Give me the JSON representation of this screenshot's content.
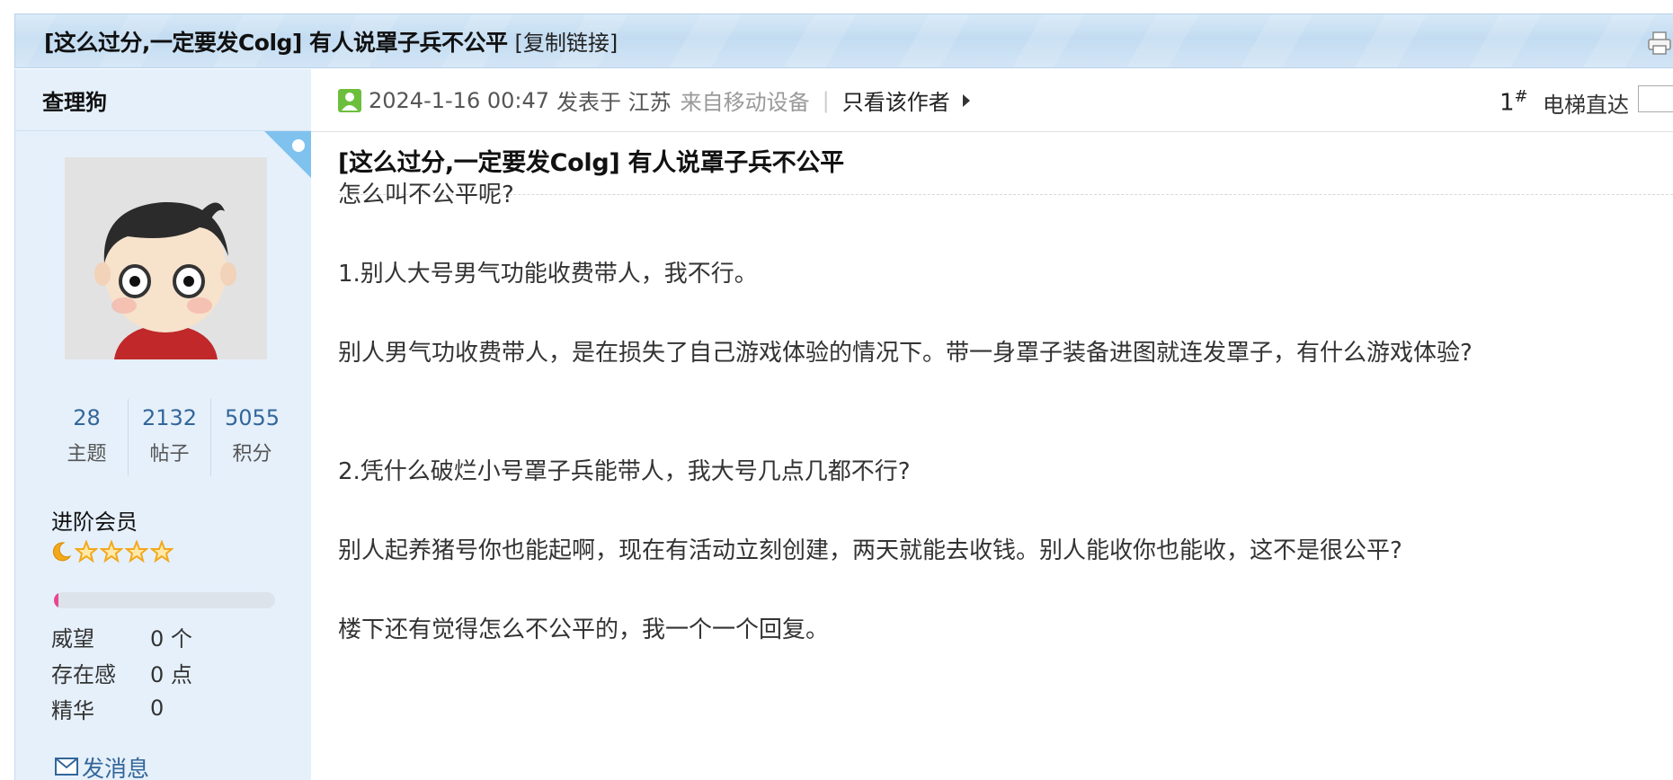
{
  "thread": {
    "title": "[这么过分,一定要发Colg] 有人说罩子兵不公平",
    "copy_link": "[复制链接]"
  },
  "author": {
    "name": "查理狗",
    "stats": [
      {
        "value": "28",
        "label": "主题"
      },
      {
        "value": "2132",
        "label": "帖子"
      },
      {
        "value": "5055",
        "label": "积分"
      }
    ],
    "level": "进阶会员",
    "level_progress": 0.02,
    "info": [
      {
        "key": "威望",
        "value": "0 个"
      },
      {
        "key": "存在感",
        "value": "0 点"
      },
      {
        "key": "精华",
        "value": "0"
      }
    ],
    "send_message": "发消息"
  },
  "post": {
    "date": "2024-1-16 00:47",
    "posted_in": "发表于 江苏",
    "mobile": "来自移动设备",
    "separator": "|",
    "only_author": "只看该作者",
    "floor": "1",
    "floor_mark": "#",
    "elevator": "电梯直达",
    "title": "[这么过分,一定要发Colg] 有人说罩子兵不公平",
    "paragraphs": [
      "怎么叫不公平呢?",
      "1.别人大号男气功能收费带人，我不行。",
      "别人男气功收费带人，是在损失了自己游戏体验的情况下。带一身罩子装备进图就连发罩子，有什么游戏体验?",
      "2.凭什么破烂小号罩子兵能带人，我大号几点几都不行?",
      "别人起养猪号你也能起啊，现在有活动立刻创建，两天就能去收钱。别人能收你也能收，这不是很公平?",
      "楼下还有觉得怎么不公平的，我一个一个回复。"
    ]
  },
  "colors": {
    "link": "#336699",
    "sidebar_bg": "#e5f0fb",
    "online": "#6cbf3c",
    "progress": "#e9468f",
    "star": "#f3a81c"
  }
}
